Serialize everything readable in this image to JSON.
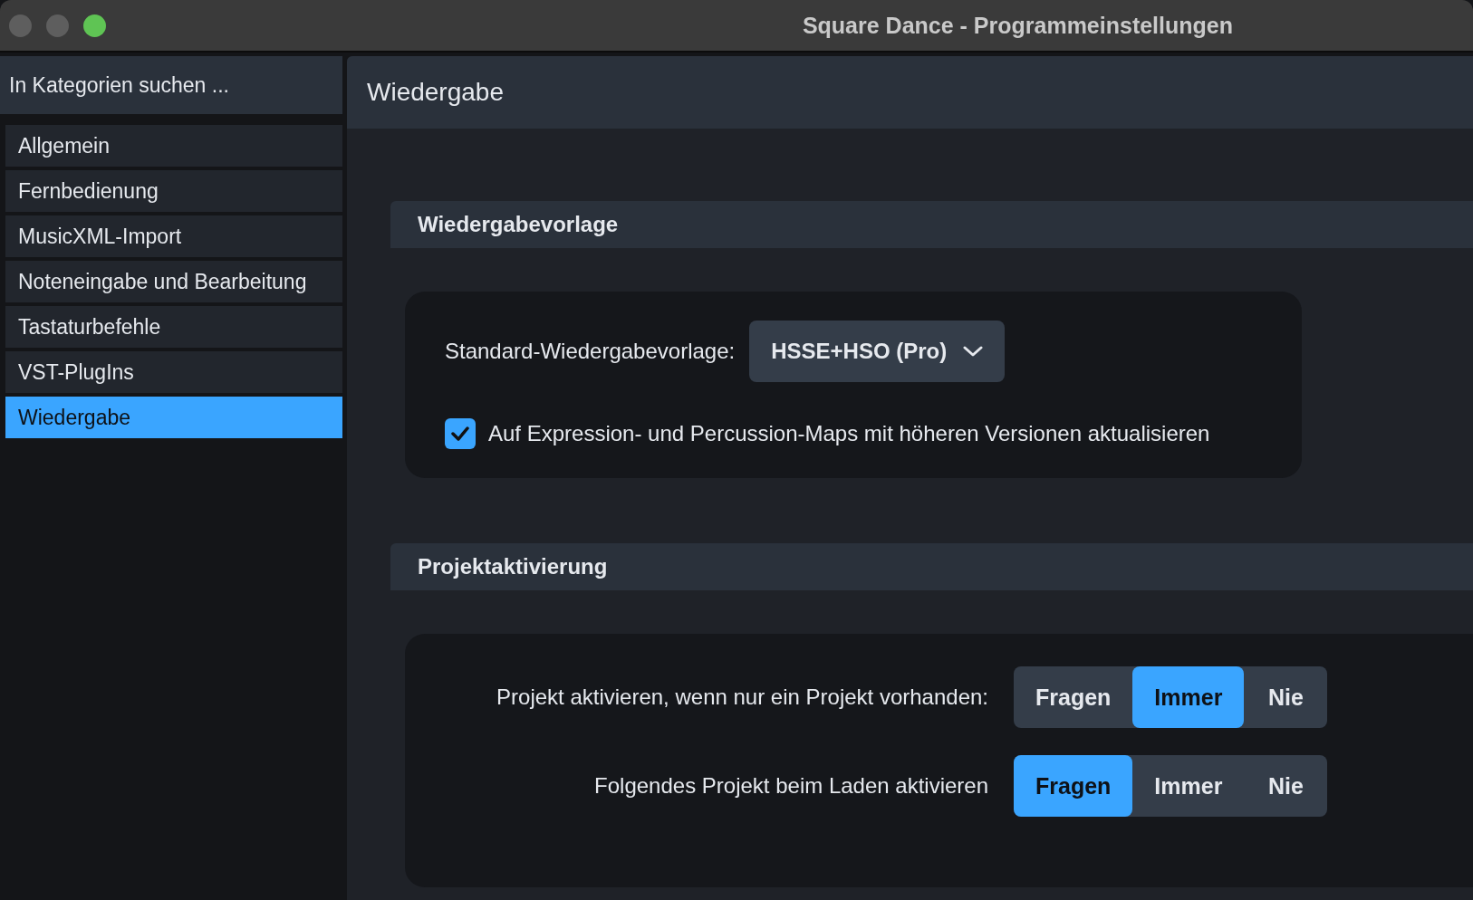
{
  "window": {
    "title": "Square Dance - Programmeinstellungen"
  },
  "sidebar": {
    "search": {
      "placeholder": "In Kategorien suchen ..."
    },
    "items": [
      {
        "label": "Allgemein",
        "selected": false
      },
      {
        "label": "Fernbedienung",
        "selected": false
      },
      {
        "label": "MusicXML-Import",
        "selected": false
      },
      {
        "label": "Noteneingabe und Bearbeitung",
        "selected": false
      },
      {
        "label": "Tastaturbefehle",
        "selected": false
      },
      {
        "label": "VST-PlugIns",
        "selected": false
      },
      {
        "label": "Wiedergabe",
        "selected": true
      }
    ]
  },
  "page": {
    "title": "Wiedergabe"
  },
  "sections": [
    {
      "title": "Wiedergabevorlage",
      "rows": [
        {
          "kind": "dropdown",
          "label": "Standard-Wiedergabevorlage:",
          "value": "HSSE+HSO (Pro)"
        },
        {
          "kind": "checkbox",
          "label": "Auf Expression- und Percussion-Maps mit höheren Versionen aktualisieren",
          "checked": true
        }
      ]
    },
    {
      "title": "Projektaktivierung",
      "rows": [
        {
          "kind": "segmented",
          "label": "Projekt aktivieren, wenn nur ein Projekt vorhanden:",
          "options": [
            {
              "label": "Fragen",
              "selected": false
            },
            {
              "label": "Immer",
              "selected": true
            },
            {
              "label": "Nie",
              "selected": false
            }
          ]
        },
        {
          "kind": "segmented",
          "label": "Folgendes Projekt beim Laden aktivieren",
          "options": [
            {
              "label": "Fragen",
              "selected": true
            },
            {
              "label": "Immer",
              "selected": false
            },
            {
              "label": "Nie",
              "selected": false
            }
          ]
        }
      ]
    }
  ]
}
